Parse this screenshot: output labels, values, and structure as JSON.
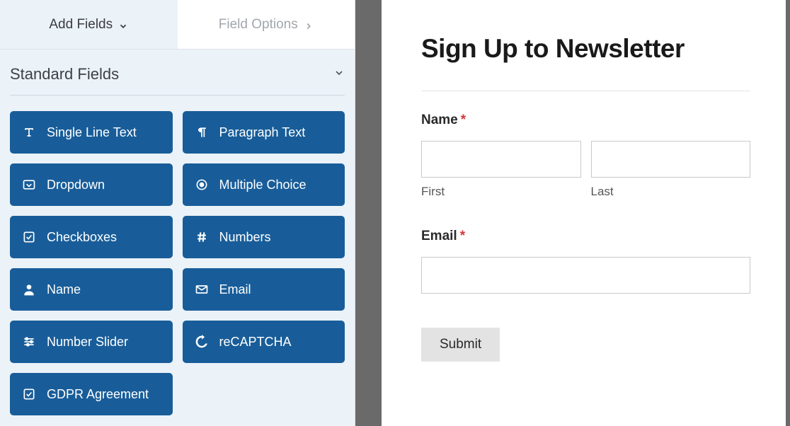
{
  "tabs": {
    "add_fields": "Add Fields",
    "field_options": "Field Options"
  },
  "section": {
    "standard_fields": "Standard Fields"
  },
  "fields": [
    {
      "icon": "text-icon",
      "label": "Single Line Text"
    },
    {
      "icon": "paragraph-icon",
      "label": "Paragraph Text"
    },
    {
      "icon": "dropdown-icon",
      "label": "Dropdown"
    },
    {
      "icon": "radio-icon",
      "label": "Multiple Choice"
    },
    {
      "icon": "checkbox-icon",
      "label": "Checkboxes"
    },
    {
      "icon": "hash-icon",
      "label": "Numbers"
    },
    {
      "icon": "person-icon",
      "label": "Name"
    },
    {
      "icon": "envelope-icon",
      "label": "Email"
    },
    {
      "icon": "sliders-icon",
      "label": "Number Slider"
    },
    {
      "icon": "recaptcha-icon",
      "label": "reCAPTCHA"
    },
    {
      "icon": "checkbox-icon",
      "label": "GDPR Agreement"
    }
  ],
  "form": {
    "title": "Sign Up to Newsletter",
    "name_label": "Name",
    "first_sublabel": "First",
    "last_sublabel": "Last",
    "email_label": "Email",
    "submit_label": "Submit",
    "required_marker": "*"
  }
}
